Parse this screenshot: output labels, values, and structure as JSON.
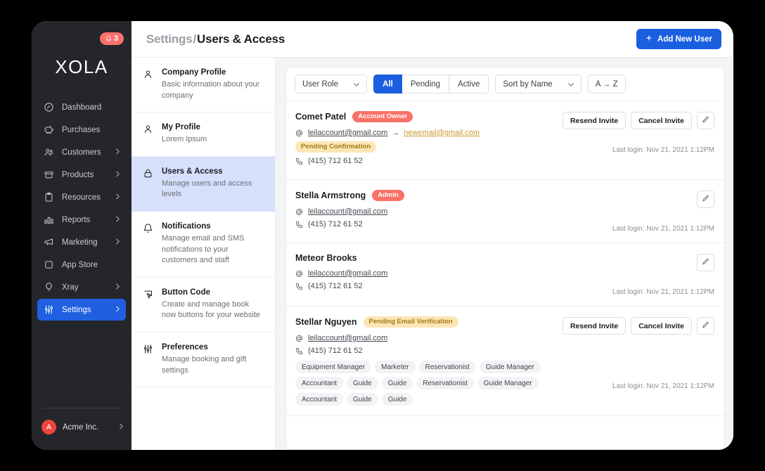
{
  "sidebar": {
    "notification_badge": {
      "icon": "bell-icon",
      "count": "3"
    },
    "brand": "XOLA",
    "items": [
      {
        "label": "Dashboard",
        "icon": "dashboard-icon",
        "chevron": false,
        "active": false
      },
      {
        "label": "Purchases",
        "icon": "piggy-bank-icon",
        "chevron": false,
        "active": false
      },
      {
        "label": "Customers",
        "icon": "users-icon",
        "chevron": true,
        "active": false
      },
      {
        "label": "Products",
        "icon": "box-icon",
        "chevron": true,
        "active": false
      },
      {
        "label": "Resources",
        "icon": "clipboard-icon",
        "chevron": true,
        "active": false
      },
      {
        "label": "Reports",
        "icon": "bar-chart-icon",
        "chevron": true,
        "active": false
      },
      {
        "label": "Marketing",
        "icon": "megaphone-icon",
        "chevron": true,
        "active": false
      },
      {
        "label": "App Store",
        "icon": "square-icon",
        "chevron": false,
        "active": false
      },
      {
        "label": "Xray",
        "icon": "lightbulb-icon",
        "chevron": true,
        "active": false
      },
      {
        "label": "Settings",
        "icon": "sliders-icon",
        "chevron": true,
        "active": true
      }
    ],
    "org": {
      "label": "Acme Inc.",
      "avatar_icon": "acme-logo-icon",
      "chevron": true
    }
  },
  "header": {
    "breadcrumb_parent": "Settings",
    "breadcrumb_sep": "/",
    "breadcrumb_current": "Users & Access",
    "add_user_label": "Add New User",
    "add_user_icon": "plus-icon"
  },
  "settings_menu": [
    {
      "title": "Company Profile",
      "desc": "Basic information about your company",
      "icon": "user-icon",
      "active": false
    },
    {
      "title": "My Profile",
      "desc": "Lorem Ipsum",
      "icon": "user-icon",
      "active": false
    },
    {
      "title": "Users & Access",
      "desc": "Manage users and access levels",
      "icon": "lock-icon",
      "active": true
    },
    {
      "title": "Notifications",
      "desc": "Manage email and SMS notifications to your customers and staff",
      "icon": "bell-icon",
      "active": false
    },
    {
      "title": "Button Code",
      "desc": "Create and manage book now buttons for your website",
      "icon": "cursor-click-icon",
      "active": false
    },
    {
      "title": "Preferences",
      "desc": "Manage booking and gift settings",
      "icon": "sliders-icon",
      "active": false
    }
  ],
  "filters": {
    "user_role": {
      "label": "User Role",
      "icon": "chevron-down-icon"
    },
    "segments": [
      {
        "label": "All",
        "active": true
      },
      {
        "label": "Pending",
        "active": false
      },
      {
        "label": "Active",
        "active": false
      }
    ],
    "sort": {
      "label": "Sort by Name",
      "icon": "chevron-down-icon"
    },
    "direction": {
      "label": "A → Z"
    }
  },
  "users": [
    {
      "name": "Comet Patel",
      "badge": {
        "label": "Account Owner",
        "style": "red"
      },
      "email": "leilaccount@gmail.com",
      "email_new": "newemail@gmail.com",
      "email_arrow": "→",
      "email_status": {
        "label": "Pending Confirmation",
        "style": "amber"
      },
      "phone": "(415) 712 61 52",
      "tags": [],
      "actions": [
        "Resend Invite",
        "Cancel Invite"
      ],
      "edit_icon": "pencil-icon",
      "last_login": "Last login: Nov 21, 2021 1:12PM"
    },
    {
      "name": "Stella Armstrong",
      "badge": {
        "label": "Admin",
        "style": "red"
      },
      "email": "leilaccount@gmail.com",
      "email_new": null,
      "email_arrow": null,
      "email_status": null,
      "phone": "(415) 712 61 52",
      "tags": [],
      "actions": [],
      "edit_icon": "pencil-icon",
      "last_login": "Last login: Nov 21, 2021 1:12PM"
    },
    {
      "name": "Meteor Brooks",
      "badge": null,
      "email": "leilaccount@gmail.com",
      "email_new": null,
      "email_arrow": null,
      "email_status": null,
      "phone": "(415) 712 61 52",
      "tags": [],
      "actions": [],
      "edit_icon": "pencil-icon",
      "last_login": "Last login: Nov 21, 2021 1:12PM"
    },
    {
      "name": "Stellar Nguyen",
      "badge": {
        "label": "Pending Email Verification",
        "style": "amber"
      },
      "email": "leilaccount@gmail.com",
      "email_new": null,
      "email_arrow": null,
      "email_status": null,
      "phone": "(415) 712 61 52",
      "tags": [
        "Equipment Manager",
        "Marketer",
        "Reservationist",
        "Guide Manager",
        "Accountant",
        "Guide",
        "Guide",
        "Reservationist",
        "Guide Manager",
        "Accountant",
        "Guide",
        "Guide"
      ],
      "actions": [
        "Resend Invite",
        "Cancel Invite"
      ],
      "edit_icon": "pencil-icon",
      "last_login": "Last login: Nov 21, 2021 1:12PM"
    }
  ],
  "colors": {
    "accent_blue": "#1A5FE0",
    "sidebar_dark": "#24262B",
    "badge_red": "#FA7168",
    "badge_amber_bg": "#FBE6B4",
    "badge_amber_text": "#A37A16",
    "active_menu_blue": "#D6E0FB"
  }
}
